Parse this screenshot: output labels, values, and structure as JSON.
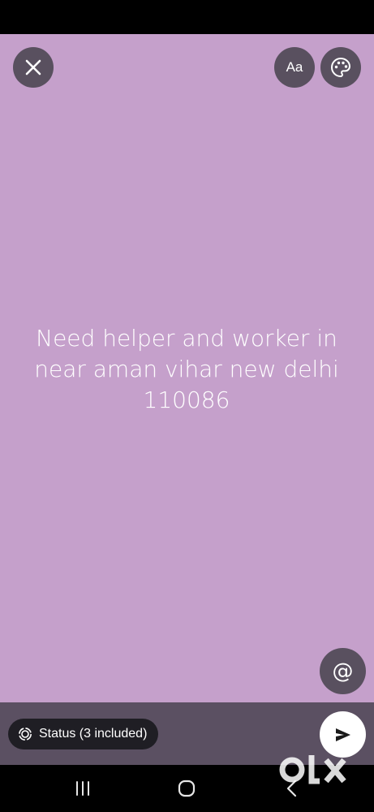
{
  "colors": {
    "canvas_background": "#c5a0cb",
    "button_background": "#59505f",
    "bottom_bar": "#5b5062",
    "pill_background": "#1f1e24",
    "send_button": "#ffffff"
  },
  "toolbar": {
    "close_icon": "close-icon",
    "text_style_label": "Aa",
    "palette_icon": "palette-icon"
  },
  "status": {
    "text_lines": [
      "Need helper and worker in",
      "near aman vihar new delhi",
      "110086"
    ]
  },
  "mention": {
    "label": "@"
  },
  "audience": {
    "label": "Status (3 included)",
    "icon": "status-ring-icon"
  },
  "send": {
    "icon": "send-icon"
  },
  "navigation": {
    "recent_icon": "recent-apps-icon",
    "home_icon": "home-icon",
    "back_icon": "back-icon"
  },
  "watermark": {
    "text": "olx"
  }
}
